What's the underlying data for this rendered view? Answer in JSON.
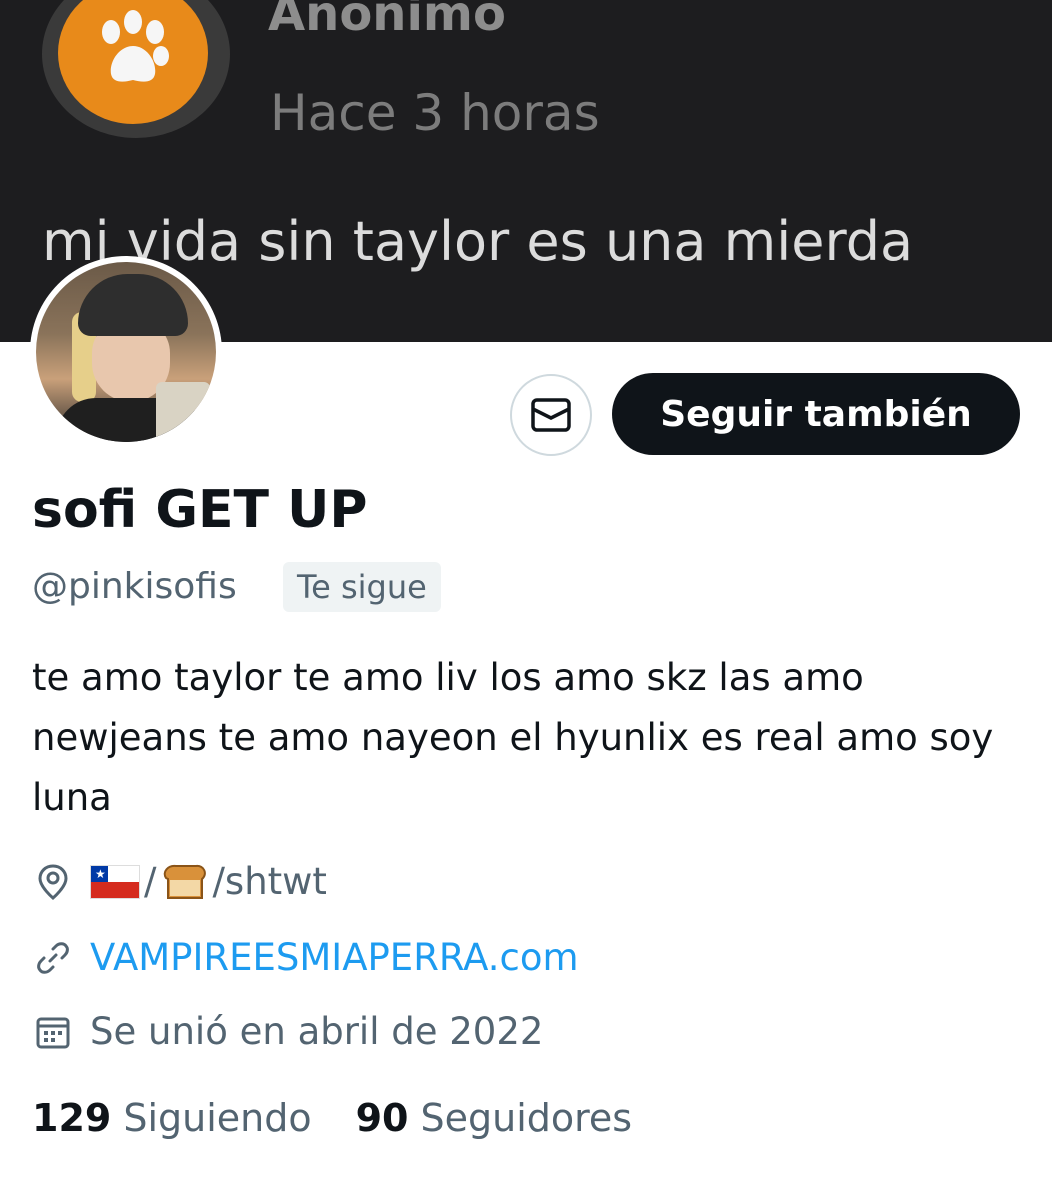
{
  "banner": {
    "author": "Anonimo",
    "time": "Hace 3 horas",
    "text": "mi vida sin taylor es una mierda"
  },
  "profile": {
    "display_name": "sofi GET UP",
    "handle": "@pinkisofis",
    "follows_you": "Te sigue",
    "bio": "te amo taylor te amo liv los amo skz las amo newjeans te amo nayeon el hyunlix es real amo soy luna",
    "location_text": "/shtwt",
    "location_sep": "/",
    "website": "VAMPIREESMIAPERRA.com",
    "joined": "Se unió en abril de 2022"
  },
  "actions": {
    "follow_label": "Seguir también",
    "message_icon": "envelope-icon"
  },
  "stats": {
    "following_count": "129",
    "following_label": "Siguiendo",
    "followers_count": "90",
    "followers_label": "Seguidores"
  },
  "colors": {
    "link": "#1d9bf0",
    "primary_button": "#0f1419",
    "secondary_text": "#536471",
    "banner_bg": "#1d1d1f"
  }
}
